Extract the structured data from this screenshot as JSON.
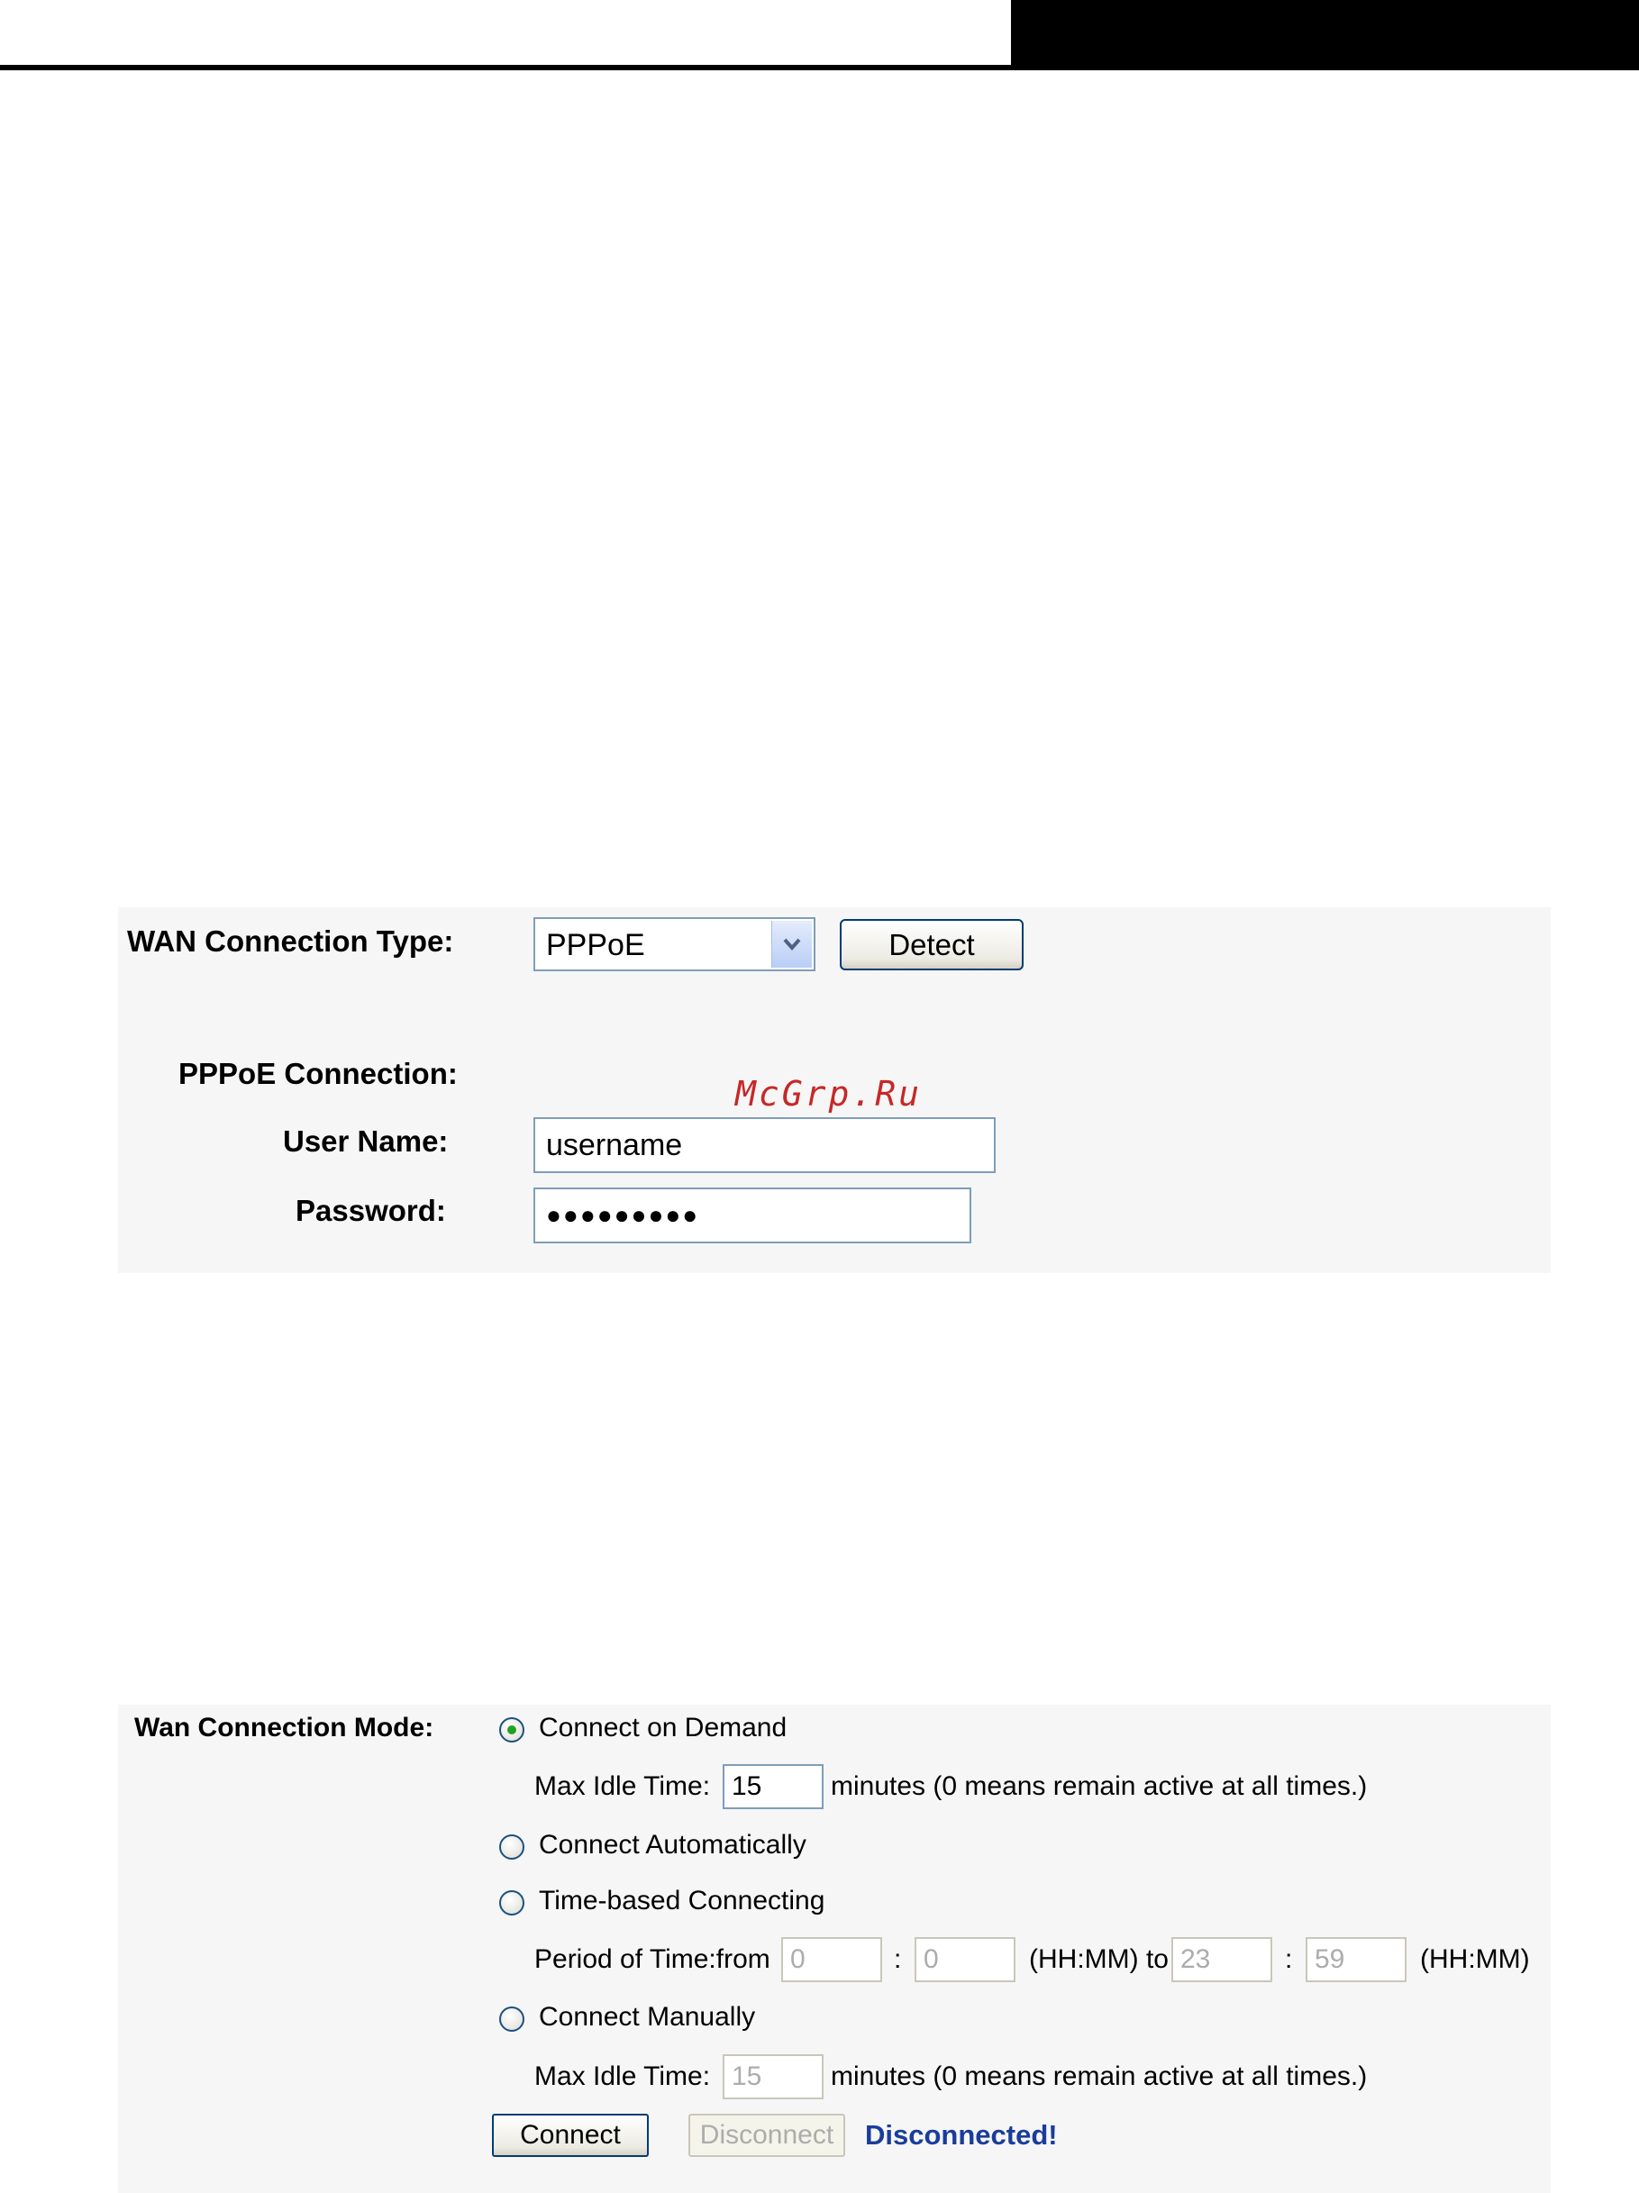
{
  "wan_type": {
    "label": "WAN Connection Type:",
    "selected": "PPPoE",
    "detect_button": "Detect"
  },
  "pppoe": {
    "section_label": "PPPoE Connection:",
    "username_label": "User Name:",
    "username_value": "username",
    "password_label": "Password:",
    "password_value": "●●●●●●●●●"
  },
  "watermark": "McGrp.Ru",
  "mode": {
    "label": "Wan Connection Mode:",
    "selected_option": "Connect on Demand",
    "options": {
      "demand": "Connect on Demand",
      "automatic": "Connect Automatically",
      "time_based": "Time-based Connecting",
      "manual": "Connect Manually"
    },
    "demand_idle_label": "Max Idle Time:",
    "demand_idle_value": "15",
    "demand_idle_note": "minutes (0 means remain active at all times.)",
    "period_label": "Period of Time:from",
    "period_from_hh": "0",
    "period_from_mm": "0",
    "colon": ":",
    "period_to_label": "(HH:MM) to",
    "period_to_hh": "23",
    "period_to_mm": "59",
    "period_end_label": "(HH:MM)",
    "manual_idle_label": "Max Idle Time:",
    "manual_idle_value": "15",
    "manual_idle_note": "minutes (0 means remain active at all times.)",
    "connect_button": "Connect",
    "disconnect_button": "Disconnect",
    "status": "Disconnected!"
  },
  "colors": {
    "panel_bg": "#f6f6f6",
    "status_text": "#1a3d9a",
    "watermark": "#c62828",
    "input_border": "#7f9db9"
  }
}
